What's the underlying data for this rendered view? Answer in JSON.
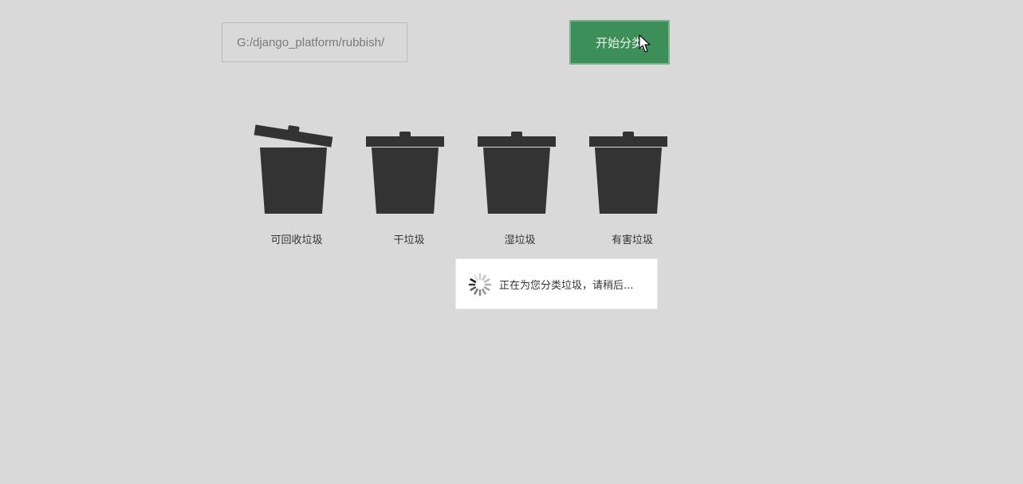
{
  "toolbar": {
    "path_input_value": "G:/django_platform/rubbish/",
    "start_button_label": "开始分类"
  },
  "bins": [
    {
      "label": "可回收垃圾",
      "lid": "open"
    },
    {
      "label": "干垃圾",
      "lid": "closed"
    },
    {
      "label": "湿垃圾",
      "lid": "closed"
    },
    {
      "label": "有害垃圾",
      "lid": "closed"
    }
  ],
  "loading_toast": {
    "message": "正在为您分类垃圾，请稍后..."
  },
  "colors": {
    "background": "#d9d9d9",
    "accent": "#3c8f58",
    "bin": "#333333"
  }
}
